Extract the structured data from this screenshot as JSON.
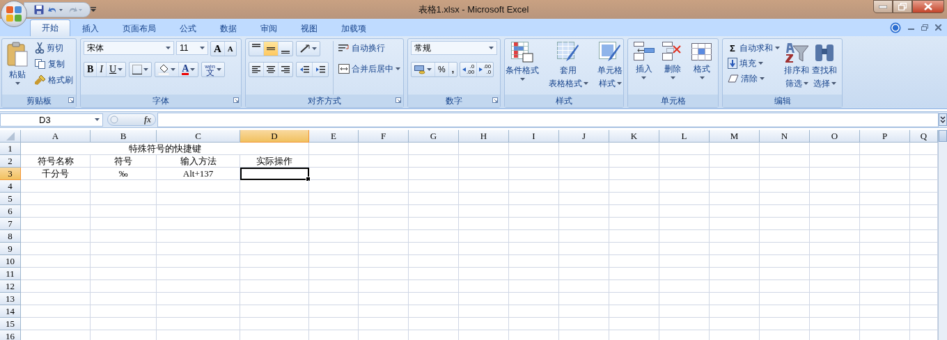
{
  "window": {
    "title": "表格1.xlsx - Microsoft Excel"
  },
  "tabs": [
    {
      "label": "开始",
      "selected": true
    },
    {
      "label": "插入",
      "selected": false
    },
    {
      "label": "页面布局",
      "selected": false
    },
    {
      "label": "公式",
      "selected": false
    },
    {
      "label": "数据",
      "selected": false
    },
    {
      "label": "审阅",
      "selected": false
    },
    {
      "label": "视图",
      "selected": false
    },
    {
      "label": "加载项",
      "selected": false
    }
  ],
  "ribbon": {
    "clipboard": {
      "label": "剪贴板",
      "paste": "粘贴",
      "items": [
        {
          "kind": "cut",
          "label": "剪切"
        },
        {
          "kind": "copy",
          "label": "复制"
        },
        {
          "kind": "painter",
          "label": "格式刷"
        }
      ]
    },
    "font": {
      "label": "字体",
      "font_name": "宋体",
      "font_size": "11",
      "size_buttons": [
        {
          "kind": "grow",
          "label": "A"
        },
        {
          "kind": "shrink",
          "label": "A"
        }
      ],
      "style_buttons": [
        {
          "kind": "bold",
          "label": "B"
        },
        {
          "kind": "italic",
          "label": "I"
        },
        {
          "kind": "underline",
          "label": "U"
        }
      ],
      "font_color": {
        "label": "A"
      },
      "phonetic": {
        "pinyin": "wén",
        "label": "文"
      }
    },
    "alignment": {
      "label": "对齐方式",
      "vertical": [
        {
          "kind": "top",
          "selected": false
        },
        {
          "kind": "middle",
          "selected": true
        },
        {
          "kind": "bottom",
          "selected": false
        }
      ],
      "horizontal": [
        {
          "kind": "left",
          "selected": false
        },
        {
          "kind": "center",
          "selected": false
        },
        {
          "kind": "right",
          "selected": false
        }
      ],
      "wrap": "自动换行",
      "merge": "合并后居中"
    },
    "number": {
      "label": "数字",
      "format": "常规",
      "percent": "%",
      "comma": ",",
      "decimals": [
        {
          "kind": "increase",
          "top": ".0",
          "bottom": ".00"
        },
        {
          "kind": "decrease",
          "top": ".00",
          "bottom": ".0"
        }
      ]
    },
    "styles": {
      "label": "样式",
      "buttons": [
        {
          "kind": "conditional",
          "lines": [
            "条件格式"
          ]
        },
        {
          "kind": "table",
          "lines": [
            "套用",
            "表格格式"
          ]
        },
        {
          "kind": "cell",
          "lines": [
            "单元格",
            "样式"
          ]
        }
      ]
    },
    "cells": {
      "label": "单元格",
      "buttons": [
        {
          "kind": "insert",
          "label": "插入"
        },
        {
          "kind": "delete",
          "label": "删除"
        },
        {
          "kind": "format",
          "label": "格式"
        }
      ]
    },
    "editing": {
      "label": "编辑",
      "sum_sign": "Σ",
      "small": [
        {
          "kind": "sum",
          "label": "自动求和"
        },
        {
          "kind": "fill",
          "label": "填充"
        },
        {
          "kind": "clear",
          "label": "清除"
        }
      ],
      "large": [
        {
          "kind": "sort",
          "lines": [
            "排序和",
            "筛选"
          ]
        },
        {
          "kind": "find",
          "lines": [
            "查找和",
            "选择"
          ]
        }
      ]
    }
  },
  "formula_bar": {
    "name_box": "D3",
    "fx": "fx"
  },
  "sheet": {
    "columns": [
      {
        "label": "A",
        "selected": false
      },
      {
        "label": "B",
        "selected": false
      },
      {
        "label": "C",
        "selected": false
      },
      {
        "label": "D",
        "selected": true
      },
      {
        "label": "E",
        "selected": false
      },
      {
        "label": "F",
        "selected": false
      },
      {
        "label": "G",
        "selected": false
      },
      {
        "label": "H",
        "selected": false
      },
      {
        "label": "I",
        "selected": false
      },
      {
        "label": "J",
        "selected": false
      },
      {
        "label": "K",
        "selected": false
      },
      {
        "label": "L",
        "selected": false
      },
      {
        "label": "M",
        "selected": false
      },
      {
        "label": "N",
        "selected": false
      },
      {
        "label": "O",
        "selected": false
      },
      {
        "label": "P",
        "selected": false
      },
      {
        "label": "Q",
        "selected": false
      }
    ],
    "rows": [
      {
        "header": "1",
        "selected": false,
        "merged_text": "特殊符号的快捷键",
        "cells": []
      },
      {
        "header": "2",
        "selected": false,
        "cells": [
          {
            "text": "符号名称"
          },
          {
            "text": "符号"
          },
          {
            "text": "输入方法"
          },
          {
            "text": "实际操作"
          }
        ]
      },
      {
        "header": "3",
        "selected": true,
        "cells": [
          {
            "text": "千分号"
          },
          {
            "text": "‰"
          },
          {
            "text": "Alt+137"
          },
          {
            "active": true
          }
        ]
      },
      {
        "header": "4",
        "selected": false,
        "cells": []
      },
      {
        "header": "5",
        "selected": false,
        "cells": []
      },
      {
        "header": "6",
        "selected": false,
        "cells": []
      },
      {
        "header": "7",
        "selected": false,
        "cells": []
      },
      {
        "header": "8",
        "selected": false,
        "cells": []
      },
      {
        "header": "9",
        "selected": false,
        "cells": []
      },
      {
        "header": "10",
        "selected": false,
        "cells": []
      },
      {
        "header": "11",
        "selected": false,
        "cells": []
      },
      {
        "header": "12",
        "selected": false,
        "cells": []
      },
      {
        "header": "13",
        "selected": false,
        "cells": []
      },
      {
        "header": "14",
        "selected": false,
        "cells": []
      },
      {
        "header": "15",
        "selected": false,
        "cells": []
      },
      {
        "header": "16",
        "selected": false,
        "cells": []
      }
    ]
  }
}
